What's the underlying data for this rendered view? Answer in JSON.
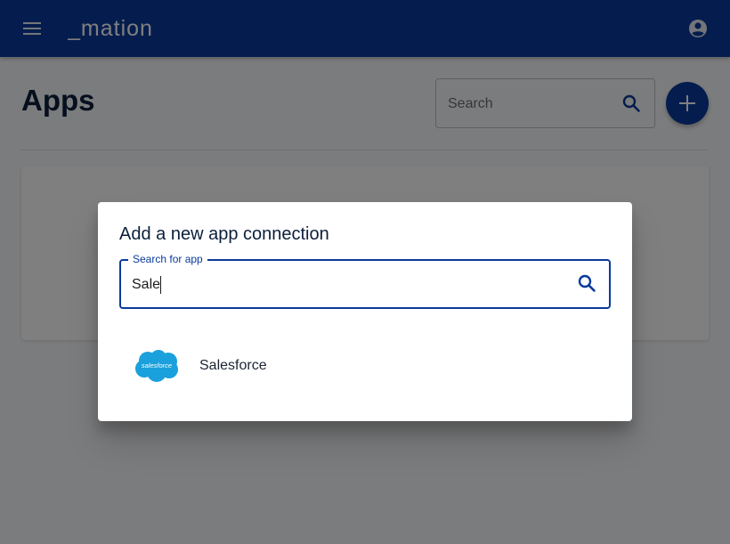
{
  "appbar": {
    "logo_text": "_mation",
    "menu_icon": "menu-icon",
    "account_icon": "account-circle-icon",
    "color": "#0a3a9c"
  },
  "page": {
    "title": "Apps",
    "search_placeholder": "Search",
    "add_button_icon": "plus-icon"
  },
  "dialog": {
    "title": "Add a new app connection",
    "search_label": "Search for app",
    "search_value": "Sale",
    "search_icon": "search-icon",
    "results": [
      {
        "name": "Salesforce",
        "logo": "salesforce-logo",
        "logo_text": "salesforce"
      }
    ]
  },
  "colors": {
    "primary": "#0a3a9c",
    "salesforce": "#1aa0dc"
  }
}
